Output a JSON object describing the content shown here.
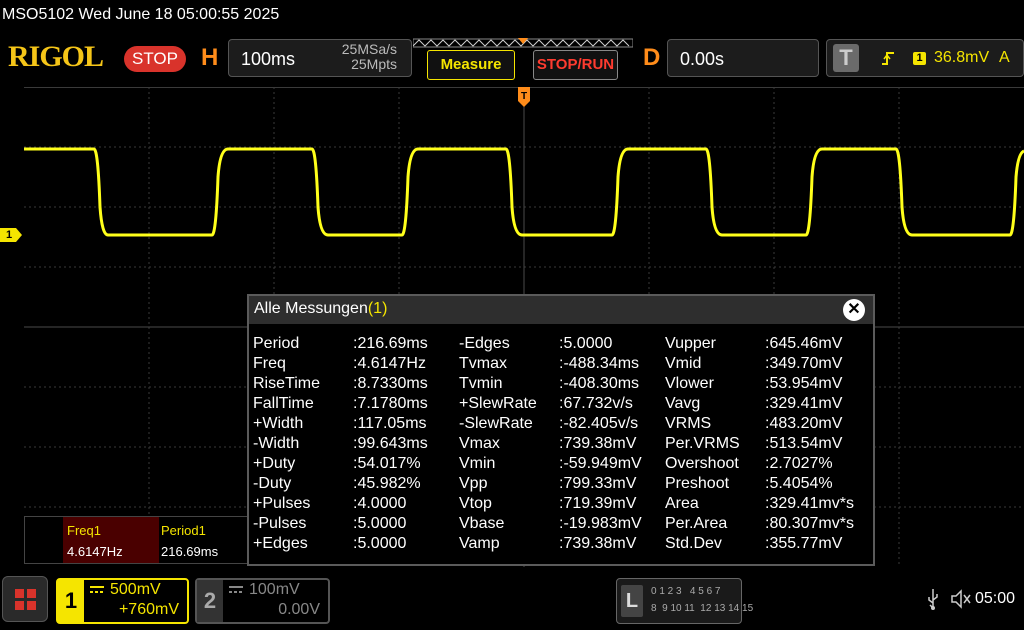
{
  "topbar": {
    "device_info": "MSO5102  Wed June 18 05:00:55 2025"
  },
  "header": {
    "logo": "RIGOL",
    "run_state": "STOP",
    "horizontal": {
      "letter": "H",
      "timebase": "100ms",
      "sample_rate": "25MSa/s",
      "memory_depth": "25Mpts"
    },
    "measure_button": "Measure",
    "stoprun_button": "STOP/RUN",
    "delay": {
      "letter": "D",
      "value": "0.00s"
    },
    "trigger": {
      "letter": "T",
      "channel": "1",
      "level": "36.8mV",
      "mode": "A"
    }
  },
  "channel_marker": "1",
  "measurements": {
    "title": "Alle Messungen",
    "title_channel": "(1)",
    "close_icon": "close-icon",
    "col1": [
      {
        "name": "Period",
        "value": ":216.69ms"
      },
      {
        "name": "Freq",
        "value": ":4.6147Hz"
      },
      {
        "name": "RiseTime",
        "value": ":8.7330ms"
      },
      {
        "name": "FallTime",
        "value": ":7.1780ms"
      },
      {
        "name": "+Width",
        "value": ":117.05ms"
      },
      {
        "name": "-Width",
        "value": ":99.643ms"
      },
      {
        "name": "+Duty",
        "value": ":54.017%"
      },
      {
        "name": "-Duty",
        "value": ":45.982%"
      },
      {
        "name": "+Pulses",
        "value": ":4.0000"
      },
      {
        "name": "-Pulses",
        "value": ":5.0000"
      },
      {
        "name": "+Edges",
        "value": ":5.0000"
      }
    ],
    "col2": [
      {
        "name": "-Edges",
        "value": ":5.0000"
      },
      {
        "name": "Tvmax",
        "value": ":-488.34ms"
      },
      {
        "name": "Tvmin",
        "value": ":-408.30ms"
      },
      {
        "name": "+SlewRate",
        "value": ":67.732v/s"
      },
      {
        "name": "-SlewRate",
        "value": ":-82.405v/s"
      },
      {
        "name": "Vmax",
        "value": ":739.38mV"
      },
      {
        "name": "Vmin",
        "value": ":-59.949mV"
      },
      {
        "name": "Vpp",
        "value": ":799.33mV"
      },
      {
        "name": "Vtop",
        "value": ":719.39mV"
      },
      {
        "name": "Vbase",
        "value": ":-19.983mV"
      },
      {
        "name": "Vamp",
        "value": ":739.38mV"
      }
    ],
    "col3": [
      {
        "name": "Vupper",
        "value": ":645.46mV"
      },
      {
        "name": "Vmid",
        "value": ":349.70mV"
      },
      {
        "name": "Vlower",
        "value": ":53.954mV"
      },
      {
        "name": "Vavg",
        "value": ":329.41mV"
      },
      {
        "name": "VRMS",
        "value": ":483.20mV"
      },
      {
        "name": "Per.VRMS",
        "value": ":513.54mV"
      },
      {
        "name": "Overshoot",
        "value": ":2.7027%"
      },
      {
        "name": "Preshoot",
        "value": ":5.4054%"
      },
      {
        "name": "Area",
        "value": ":329.41mv*s"
      },
      {
        "name": "Per.Area",
        "value": ":80.307mv*s"
      },
      {
        "name": "Std.Dev",
        "value": ":355.77mV"
      }
    ]
  },
  "quick_measure": [
    {
      "label": "Freq1",
      "value": "4.6147Hz"
    },
    {
      "label": "Period1",
      "value": "216.69ms"
    }
  ],
  "channels": [
    {
      "number": "1",
      "scale": "500mV",
      "offset": "+760mV",
      "active": true
    },
    {
      "number": "2",
      "scale": "100mV",
      "offset": "0.00V",
      "active": false
    }
  ],
  "logic": {
    "letter": "L",
    "row1": "0 1 2 3   4 5 6 7",
    "row2": "8  9 10 11  12 13 14 15"
  },
  "status": {
    "time": "05:00",
    "usb_icon": "usb-icon",
    "speaker_icon": "speaker-muted-icon"
  },
  "colors": {
    "ch1": "#f5e500",
    "accent_orange": "#ff8c1a",
    "stop_red": "#d9332b",
    "trace": "#ffff1a"
  }
}
